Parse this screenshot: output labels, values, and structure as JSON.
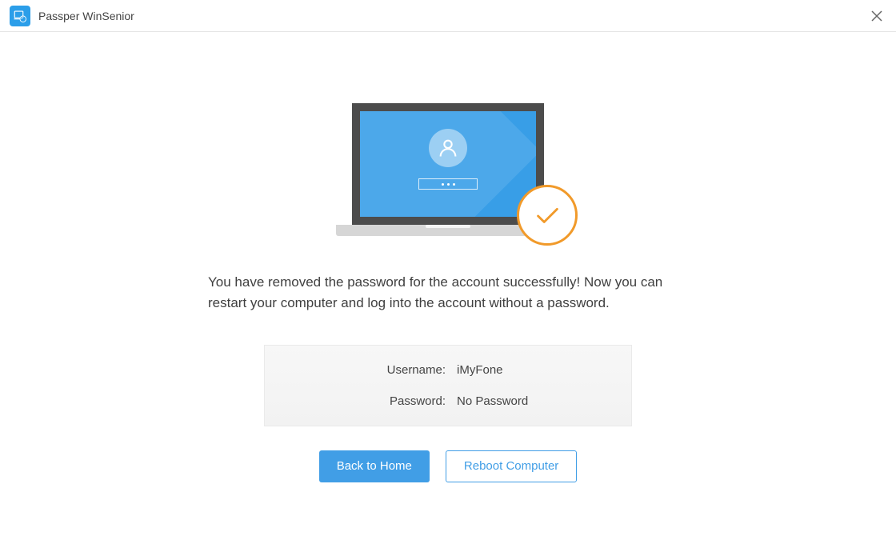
{
  "app": {
    "title": "Passper WinSenior"
  },
  "main": {
    "message": "You have removed the password for the account successfully! Now you can restart your computer and log into the account without a password.",
    "info": {
      "username_label": "Username:",
      "username_value": "iMyFone",
      "password_label": "Password:",
      "password_value": "No Password"
    },
    "buttons": {
      "back": "Back to Home",
      "reboot": "Reboot Computer"
    }
  }
}
